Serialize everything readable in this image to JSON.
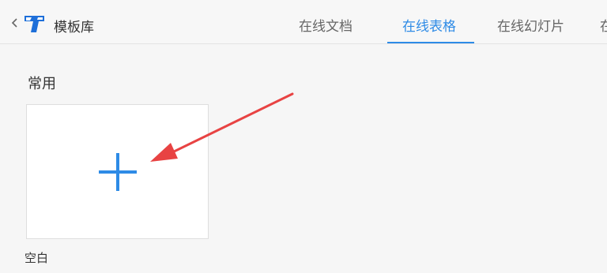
{
  "header": {
    "app_title": "模板库",
    "icons": {
      "back": "chevron-left-icon",
      "logo": "tencent-docs-logo-icon"
    },
    "brand_color": "#2e8be6"
  },
  "tabs": [
    {
      "label": "在线文档",
      "active": false
    },
    {
      "label": "在线表格",
      "active": true
    },
    {
      "label": "在线幻灯片",
      "active": false
    },
    {
      "label": "在",
      "active": false
    }
  ],
  "section": {
    "title": "常用",
    "templates": [
      {
        "label": "空白",
        "icon": "plus-icon"
      }
    ]
  },
  "annotation": {
    "color": "#e84343",
    "icon": "red-arrow-annotation"
  }
}
